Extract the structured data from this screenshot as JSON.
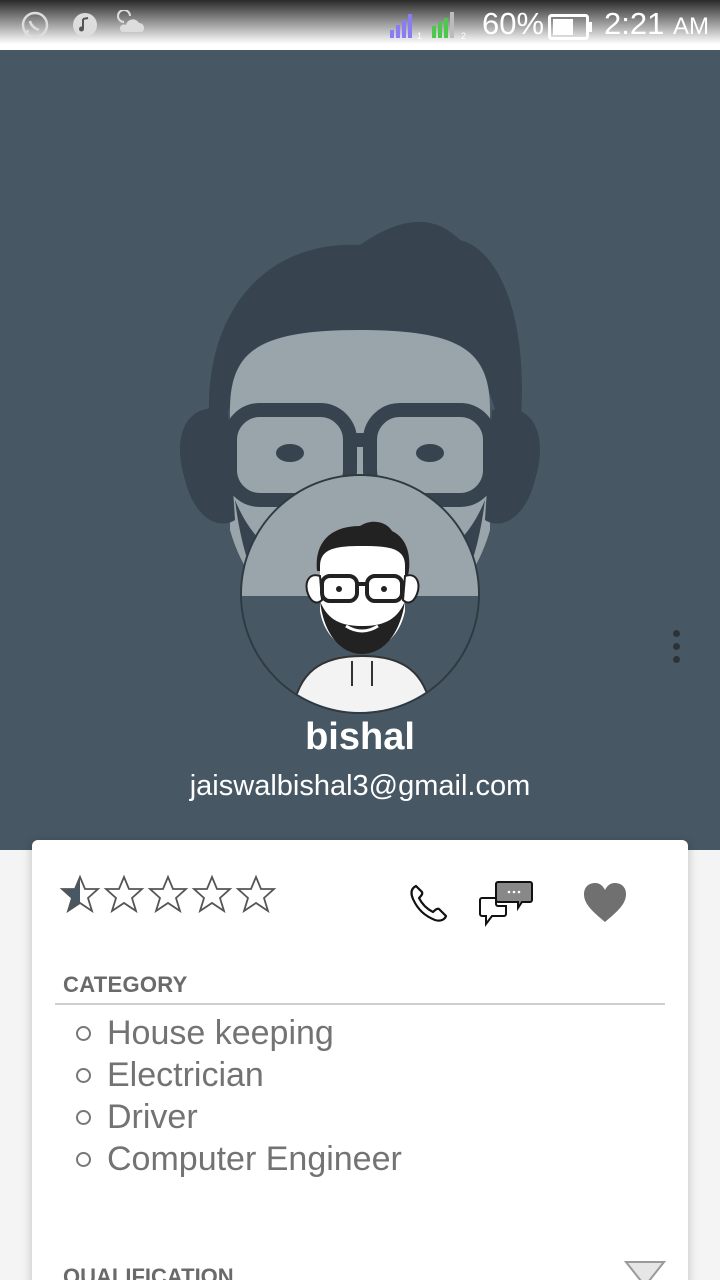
{
  "status_bar": {
    "battery": "60%",
    "time": "2:21",
    "ampm": "AM",
    "icons": [
      "whatsapp-icon",
      "music-icon",
      "weather-icon",
      "signal-sim1-icon",
      "signal-sim2-icon",
      "battery-icon"
    ]
  },
  "profile": {
    "name": "bishal",
    "email": "jaiswalbishal3@gmail.com"
  },
  "rating": {
    "value": 0.5,
    "max": 5
  },
  "actions": [
    "phone-icon",
    "chat-icon",
    "heart-icon"
  ],
  "category": {
    "title": "CATEGORY",
    "items": [
      "House keeping",
      "Electrician",
      "Driver",
      "Computer Engineer"
    ]
  },
  "qualification": {
    "title": "QUALIFICATION"
  },
  "colors": {
    "header": "#475864",
    "text_gray": "#737373",
    "card": "#ffffff"
  }
}
